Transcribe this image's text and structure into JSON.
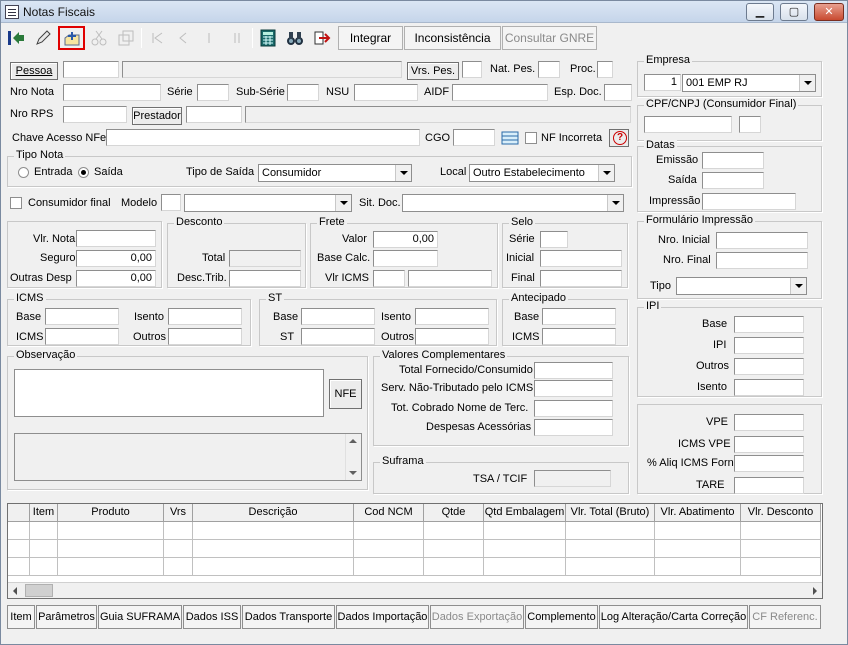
{
  "window": {
    "title": "Notas Fiscais",
    "min": "▁",
    "max": "▢",
    "close": "✕"
  },
  "toolbar": {
    "icons": [
      "exit-icon",
      "edit-icon",
      "add-document-icon",
      "cut-icon",
      "copy-icon",
      "first-record-icon",
      "previous-record-icon",
      "next-record-icon",
      "last-record-icon",
      "calculator-icon",
      "binoculars-icon",
      "export-icon"
    ],
    "integrar": "Integrar",
    "inconsistencia": "Inconsistência",
    "consultar_gnre": "Consultar GNRE"
  },
  "header": {
    "pessoa": "Pessoa",
    "vrs_pes": "Vrs. Pes.",
    "nat_pes": "Nat. Pes.",
    "proc": "Proc.",
    "nro_nota": "Nro Nota",
    "serie": "Série",
    "sub_serie": "Sub-Série",
    "nsu": "NSU",
    "aidf": "AIDF",
    "esp_doc": "Esp. Doc.",
    "nro_rps": "Nro RPS",
    "prestador": "Prestador",
    "chave": "Chave Acesso NFe",
    "cgo": "CGO",
    "nf_incorreta": "NF Incorreta"
  },
  "tipo_nota": {
    "title": "Tipo Nota",
    "entrada": "Entrada",
    "saida": "Saída",
    "tipo_saida_label": "Tipo de Saída",
    "tipo_saida_value": "Consumidor",
    "local_label": "Local",
    "local_value": "Outro Estabelecimento"
  },
  "row_consumidor": {
    "consumidor_final": "Consumidor final",
    "modelo": "Modelo",
    "sit_doc": "Sit. Doc."
  },
  "valores": {
    "vlr_nota": "Vlr. Nota",
    "seguro": "Seguro",
    "seguro_value": "0,00",
    "outras": "Outras Desp",
    "outras_value": "0,00"
  },
  "desconto": {
    "title": "Desconto",
    "total": "Total",
    "desc_trib": "Desc.Trib."
  },
  "frete": {
    "title": "Frete",
    "valor": "Valor",
    "valor_value": "0,00",
    "base_calc": "Base Calc.",
    "vlr_icms": "Vlr ICMS"
  },
  "selo": {
    "title": "Selo",
    "serie": "Série",
    "inicial": "Inicial",
    "final": "Final"
  },
  "icms": {
    "title": "ICMS",
    "base": "Base",
    "icms": "ICMS",
    "isento": "Isento",
    "outros": "Outros"
  },
  "st": {
    "title": "ST",
    "base": "Base",
    "st": "ST",
    "isento": "Isento",
    "outros": "Outros"
  },
  "antecipado": {
    "title": "Antecipado",
    "base": "Base",
    "icms": "ICMS"
  },
  "observacao": {
    "title": "Observação",
    "nfe": "NFE"
  },
  "valores_compl": {
    "title": "Valores Complementares",
    "l1": "Total Fornecido/Consumido",
    "l2": "Serv. Não-Tributado pelo ICMS",
    "l3": "Tot. Cobrado Nome de Terc.",
    "l4": "Despesas Acessórias"
  },
  "suframa": {
    "title": "Suframa",
    "tsa": "TSA / TCIF"
  },
  "empresa": {
    "title": "Empresa",
    "code": "1",
    "name": "001 EMP RJ"
  },
  "cpf": {
    "title": "CPF/CNPJ (Consumidor Final)"
  },
  "datas": {
    "title": "Datas",
    "emissao": "Emissão",
    "saida": "Saída",
    "impressao": "Impressão"
  },
  "formulario": {
    "title": "Formulário Impressão",
    "nro_inicial": "Nro. Inicial",
    "nro_final": "Nro. Final",
    "tipo": "Tipo"
  },
  "ipi": {
    "title": "IPI",
    "base": "Base",
    "ipi": "IPI",
    "outros": "Outros",
    "isento": "Isento"
  },
  "vpe": {
    "vpe": "VPE",
    "icms_vpe": "ICMS VPE",
    "aliq": "% Aliq ICMS Forn",
    "tare": "TARE"
  },
  "grid": {
    "columns": [
      "",
      "Item",
      "Produto",
      "Vrs",
      "Descrição",
      "Cod NCM",
      "Qtde",
      "Qtd Embalagem",
      "Vlr. Total (Bruto)",
      "Vlr. Abatimento",
      "Vlr. Desconto"
    ]
  },
  "tabs": [
    "Item",
    "Parâmetros",
    "Guia SUFRAMA",
    "Dados ISS",
    "Dados Transporte",
    "Dados Importação",
    "Dados Exportação",
    "Complemento",
    "Log Alteração/Carta Correção",
    "CF Referenc."
  ]
}
